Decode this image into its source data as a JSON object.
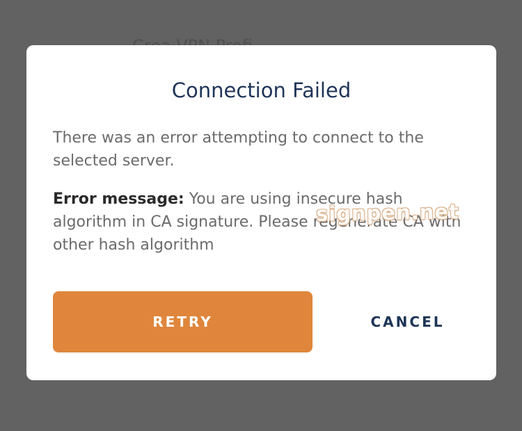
{
  "background": {
    "partial_title": "Crea VPN Profi"
  },
  "dialog": {
    "title": "Connection Failed",
    "message": "There was an error attempting to connect to the selected server.",
    "error_label": "Error message:",
    "error_message": "You are using insecure hash algorithm in CA signature. Please regenerate CA with other hash algorithm",
    "retry_label": "RETRY",
    "cancel_label": "CANCEL"
  },
  "watermark": {
    "text": "signpen.net"
  },
  "colors": {
    "overlay": "#626262",
    "dialog_bg": "#ffffff",
    "title": "#1f3558",
    "retry_bg": "#df863c",
    "cancel_text": "#1f3558",
    "body_text": "#6b6b6b"
  }
}
